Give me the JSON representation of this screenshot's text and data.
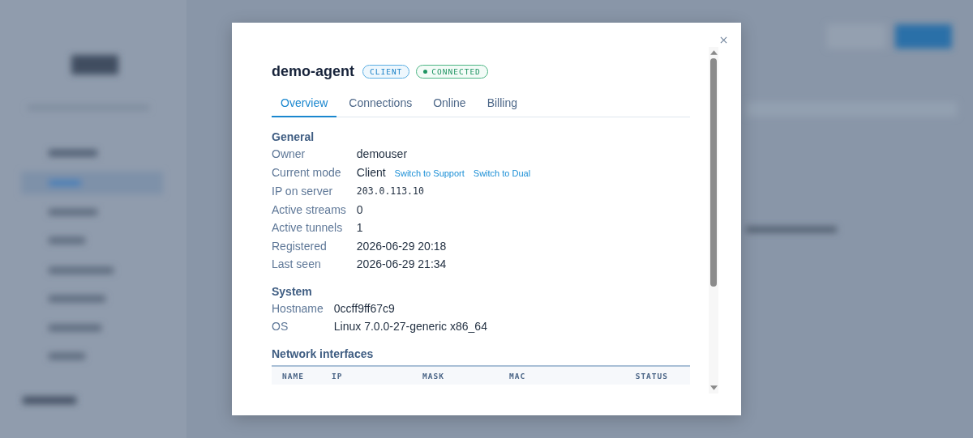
{
  "dialog": {
    "title": "demo-agent",
    "badges": [
      {
        "text": "CLIENT",
        "kind": "mode"
      },
      {
        "text": "CONNECTED",
        "kind": "status"
      }
    ],
    "tabs": [
      {
        "label": "Overview",
        "selected": true
      },
      {
        "label": "Connections",
        "selected": false
      },
      {
        "label": "Online",
        "selected": false
      },
      {
        "label": "Billing",
        "selected": false
      }
    ],
    "sections": [
      {
        "heading": "General",
        "fields": [
          {
            "label": "Owner",
            "value": "demouser",
            "kind": "text"
          },
          {
            "label": "Current mode",
            "value": "Client",
            "kind": "text",
            "links": [
              "Switch to Support",
              "Switch to Dual"
            ]
          },
          {
            "label": "IP on server",
            "value": "203.0.113.10",
            "kind": "mono"
          },
          {
            "label": "Active streams",
            "value": "0",
            "kind": "text"
          },
          {
            "label": "Active tunnels",
            "value": "1",
            "kind": "text"
          },
          {
            "label": "Registered",
            "value": "2026-06-29 20:18",
            "kind": "text"
          },
          {
            "label": "Last seen",
            "value": "2026-06-29 21:34",
            "kind": "text"
          }
        ]
      },
      {
        "heading": "System",
        "fields": [
          {
            "label": "Hostname",
            "value": "0ccff9ff67c9",
            "kind": "text"
          },
          {
            "label": "OS",
            "value": "Linux 7.0.0-27-generic x86_64",
            "kind": "text"
          }
        ]
      },
      {
        "heading": "Network interfaces",
        "table": {
          "columns": [
            "NAME",
            "IP",
            "MASK",
            "MAC",
            "STATUS"
          ]
        }
      }
    ]
  }
}
